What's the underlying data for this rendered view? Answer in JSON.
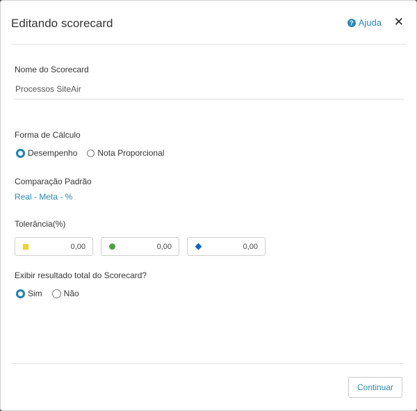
{
  "header": {
    "title": "Editando scorecard",
    "help_label": "Ajuda"
  },
  "name_section": {
    "label": "Nome do Scorecard",
    "value": "Processos SiteAir"
  },
  "calc_section": {
    "label": "Forma de Cálculo",
    "options": [
      "Desempenho",
      "Nota Proporcional"
    ],
    "selected": "Desempenho"
  },
  "comparison": {
    "label": "Comparação Padrão",
    "value": "Real - Meta - %"
  },
  "tolerance": {
    "label": "Tolerância(%)",
    "fields": [
      {
        "icon": "yellow-square-icon",
        "color": "#e8d62a",
        "value": "0,00"
      },
      {
        "icon": "green-circle-icon",
        "color": "#4aa13d",
        "value": "0,00"
      },
      {
        "icon": "blue-diamond-icon",
        "color": "#1565c0",
        "value": "0,00"
      }
    ]
  },
  "show_total": {
    "label": "Exibir resultado total do Scorecard?",
    "options": [
      "Sim",
      "Não"
    ],
    "selected": "Sim"
  },
  "footer": {
    "continue_label": "Continuar"
  }
}
